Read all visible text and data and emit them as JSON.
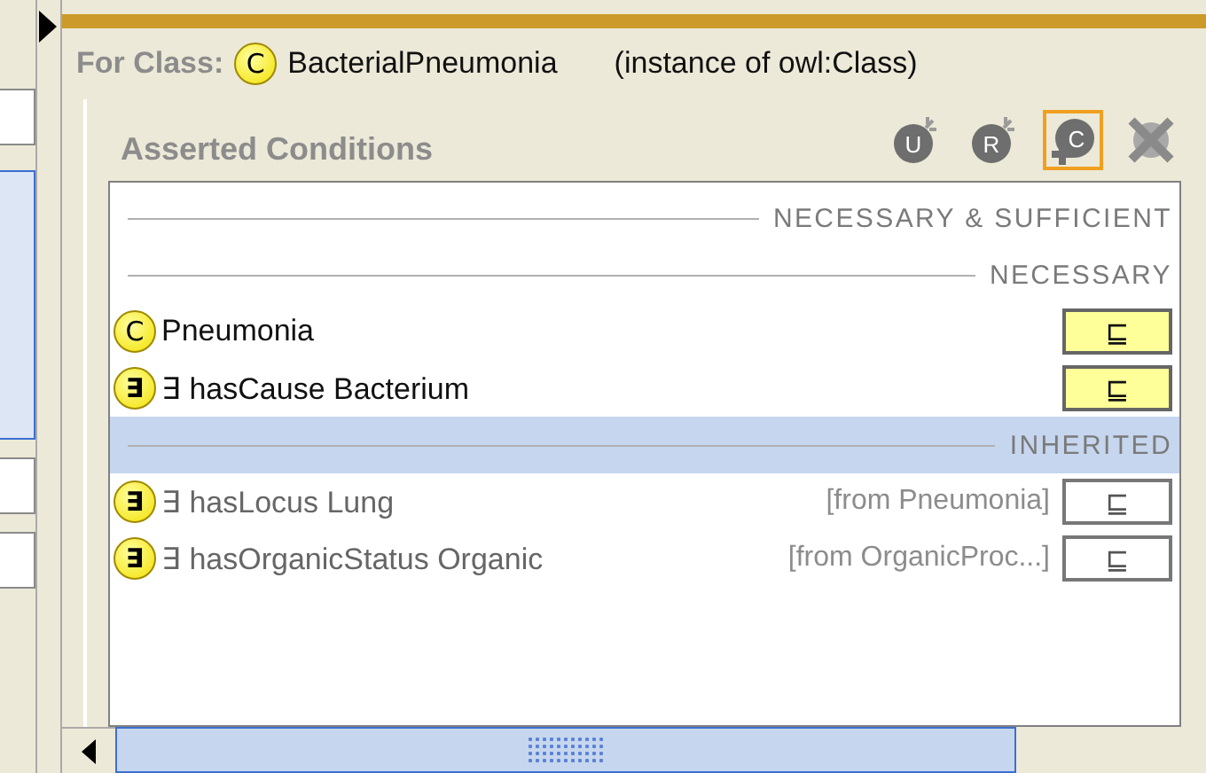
{
  "header": {
    "label": "For Class:",
    "class_icon": "C",
    "class_name": "BacterialPneumonia",
    "type_note": "(instance of owl:Class)"
  },
  "conditions": {
    "title": "Asserted Conditions",
    "toolbar": [
      {
        "kind": "bomb",
        "letter": "U",
        "selected": false
      },
      {
        "kind": "bomb",
        "letter": "R",
        "selected": false
      },
      {
        "kind": "add",
        "letter": "C",
        "selected": true
      },
      {
        "kind": "delete",
        "selected": false
      }
    ],
    "rows": [
      {
        "kind": "section",
        "label": "NECESSARY & SUFFICIENT",
        "selected": false
      },
      {
        "kind": "section",
        "label": "NECESSARY",
        "selected": false
      },
      {
        "kind": "condition",
        "icon": "C",
        "label": "Pneumonia",
        "inherited": false,
        "button": "⊑",
        "selected": false
      },
      {
        "kind": "condition",
        "icon": "∃",
        "label": "∃ hasCause Bacterium",
        "inherited": false,
        "button": "⊑",
        "selected": false
      },
      {
        "kind": "section",
        "label": "INHERITED",
        "selected": true
      },
      {
        "kind": "condition",
        "icon": "∃",
        "label": "∃ hasLocus Lung",
        "inherited": true,
        "source": "[from Pneumonia]",
        "button": "⊑",
        "selected": false
      },
      {
        "kind": "condition",
        "icon": "∃",
        "label": "∃ hasOrganicStatus Organic",
        "inherited": true,
        "source": "[from OrganicProc...]",
        "button": "⊑",
        "selected": false
      }
    ]
  }
}
